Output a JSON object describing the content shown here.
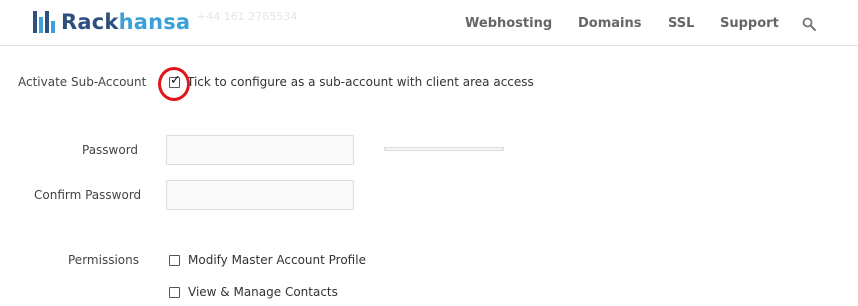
{
  "brand": {
    "name_part1": "Rack",
    "name_part2": "hansa",
    "phone": "+44 161 2765534",
    "colors": {
      "dark": "#2c4f80",
      "light": "#3aa0d8"
    }
  },
  "nav": {
    "items": [
      "Webhosting",
      "Domains",
      "SSL",
      "Support"
    ],
    "search_icon": "search-icon"
  },
  "form": {
    "activate": {
      "label": "Activate Sub-Account",
      "checked": true,
      "description": "Tick to configure as a sub-account with client area access"
    },
    "password": {
      "label": "Password",
      "value": ""
    },
    "confirm_password": {
      "label": "Confirm Password",
      "value": ""
    },
    "password_strength": 0,
    "permissions": {
      "label": "Permissions",
      "options": [
        {
          "label": "Modify Master Account Profile",
          "checked": false
        },
        {
          "label": "View & Manage Contacts",
          "checked": false
        }
      ]
    }
  },
  "annotation": {
    "color": "#e0141b"
  }
}
